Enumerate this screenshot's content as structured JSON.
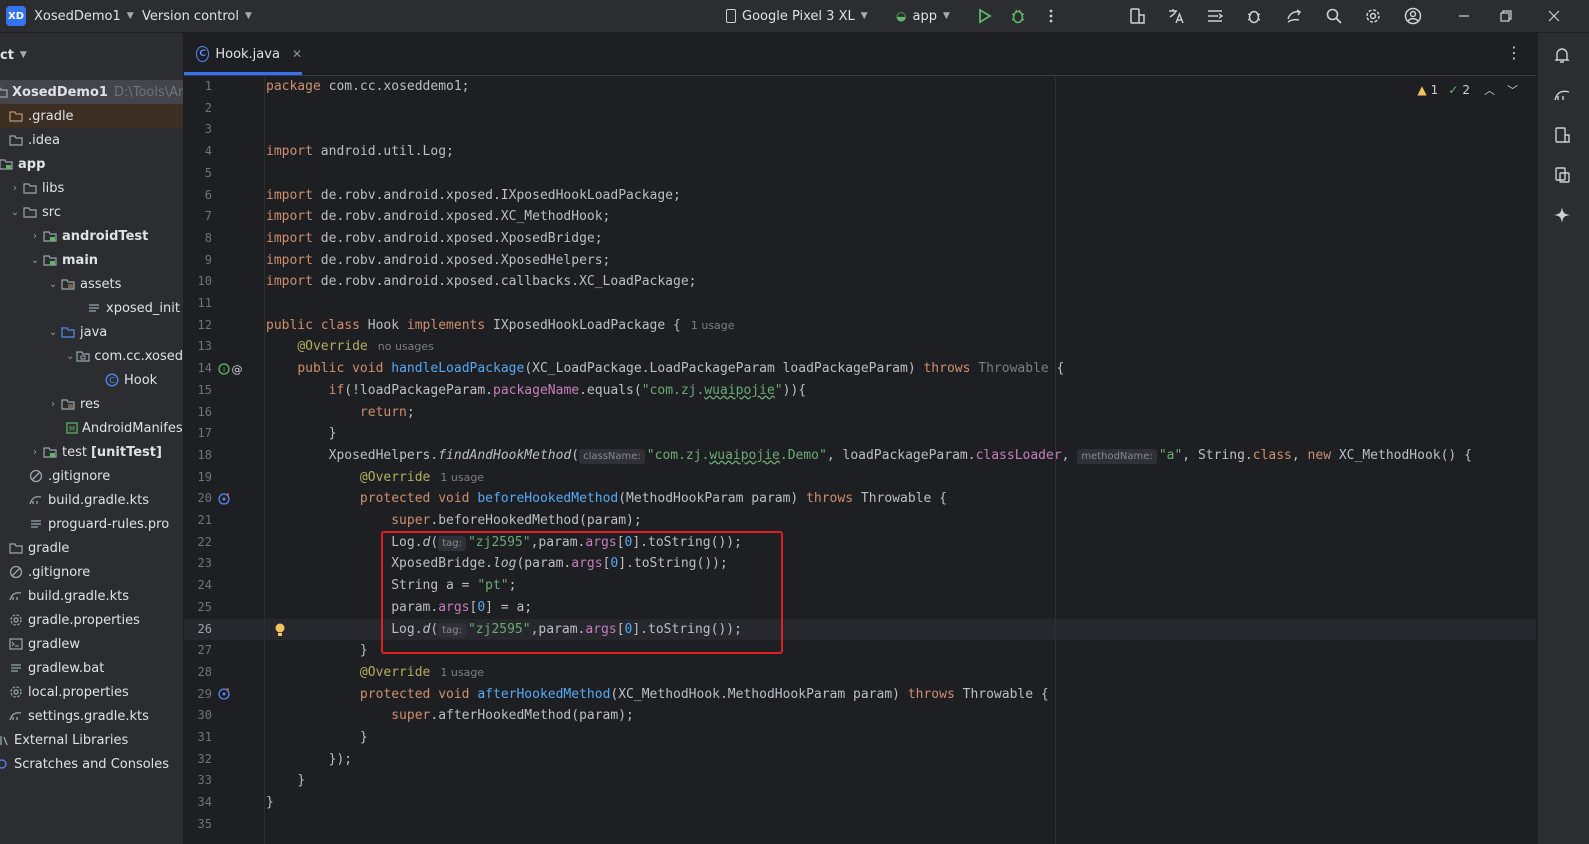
{
  "titlebar": {
    "logo": "XD",
    "project_name": "XosedDemo1",
    "vcs_label": "Version control",
    "device": "Google Pixel 3 XL",
    "run_config": "app"
  },
  "left_panel": {
    "header": "ct",
    "items": [
      {
        "label": "XosedDemo1",
        "path": "D:\\Tools\\Andro"
      },
      {
        "label": ".gradle"
      },
      {
        "label": ".idea"
      },
      {
        "label": "app"
      },
      {
        "label": "libs"
      },
      {
        "label": "src"
      },
      {
        "label": "androidTest"
      },
      {
        "label": "main"
      },
      {
        "label": "assets"
      },
      {
        "label": "xposed_init"
      },
      {
        "label": "java"
      },
      {
        "label": "com.cc.xosed"
      },
      {
        "label": "Hook"
      },
      {
        "label": "res"
      },
      {
        "label": "AndroidManifest"
      },
      {
        "label": "test",
        "suffix": "[unitTest]"
      },
      {
        "label": ".gitignore"
      },
      {
        "label": "build.gradle.kts"
      },
      {
        "label": "proguard-rules.pro"
      },
      {
        "label": "gradle"
      },
      {
        "label": ".gitignore"
      },
      {
        "label": "build.gradle.kts"
      },
      {
        "label": "gradle.properties"
      },
      {
        "label": "gradlew"
      },
      {
        "label": "gradlew.bat"
      },
      {
        "label": "local.properties"
      },
      {
        "label": "settings.gradle.kts"
      },
      {
        "label": "External Libraries"
      },
      {
        "label": "Scratches and Consoles"
      }
    ]
  },
  "editor": {
    "tab_label": "Hook.java",
    "tab_icon": "C",
    "warnings": "1",
    "checks": "2",
    "line_numbers": [
      "1",
      "2",
      "3",
      "4",
      "5",
      "6",
      "7",
      "8",
      "9",
      "10",
      "11",
      "12",
      "13",
      "14",
      "15",
      "16",
      "17",
      "18",
      "19",
      "20",
      "21",
      "22",
      "23",
      "24",
      "25",
      "26",
      "27",
      "28",
      "29",
      "30",
      "31",
      "32",
      "33",
      "34",
      "35"
    ],
    "code": {
      "l1_kw": "package",
      "l1_rest": " com.cc.xoseddemo1;",
      "imp": "import",
      "l4": " android.util.Log;",
      "l6": " de.robv.android.xposed.IXposedHookLoadPackage;",
      "l7": " de.robv.android.xposed.XC_MethodHook;",
      "l8": " de.robv.android.xposed.XposedBridge;",
      "l9": " de.robv.android.xposed.XposedHelpers;",
      "l10": " de.robv.android.xposed.callbacks.XC_LoadPackage;",
      "public": "public",
      "class": " class ",
      "hook": "Hook ",
      "implements": "implements",
      "iface": " IXposedHookLoadPackage {",
      "one_usage": "1 usage",
      "no_usages": "no usages",
      "override": "@Override",
      "void": " void ",
      "handle": "handleLoadPackage",
      "l14_params": "(XC_LoadPackage.LoadPackageParam loadPackageParam) ",
      "throws": "throws",
      "throwable_grey": " Throwable",
      "brace": " {",
      "if": "if",
      "l15_a": "(!loadPackageParam.",
      "packageName": "packageName",
      "l15_b": ".equals(",
      "q": "\"",
      "str_com": "com.zj.",
      "wuaipojie": "wuaipojie",
      "l15_c": ")){",
      "return": "return",
      "semi": ";",
      "close": "}",
      "xh": "XposedHelpers.",
      "find": "findAndHookMethod",
      "open": "(",
      "className": "className:",
      "demo": ".Demo",
      "l18_b": ", loadPackageParam.",
      "classLoader": "classLoader",
      "comma": ", ",
      "methodName": "methodName:",
      "str_a": "\"a\"",
      "l18_c": ", String.",
      "classkw": "class",
      "comma2": ", ",
      "new": "new",
      "l18_d": " XC_MethodHook() {",
      "protected": "protected",
      "before": "beforeHookedMethod",
      "l20_params": "(MethodHookParam param) ",
      "throwable": " Throwable {",
      "super": "super",
      "l21_rest": ".beforeHookedMethod(param);",
      "log": "Log.",
      "d": "d",
      "tag": "tag:",
      "str_zj": "\"zj2595\"",
      "l22_b": ",param.",
      "args": "args",
      "zero": "0",
      "l22_c": "].toString());",
      "xb": "XposedBridge.",
      "logf": "log",
      "l23_a": "(param.",
      "string_a": "String a = ",
      "str_pt": "\"pt\"",
      "param_dot": "param.",
      "l25_b": "] = a;",
      "lbr": "[",
      "after": "afterHookedMethod",
      "l29_params": "(XC_MethodHook.MethodHookParam param) ",
      "l30_rest": ".afterHookedMethod(param);",
      "l32": "});",
      "l33": "}",
      "l34": "}"
    }
  },
  "colors": {
    "keyword": "#cf8e6d",
    "function": "#56a8f5",
    "string": "#6aab73",
    "annotation": "#b3ae60",
    "field": "#c77dbb",
    "highlight_box": "#e02020"
  }
}
